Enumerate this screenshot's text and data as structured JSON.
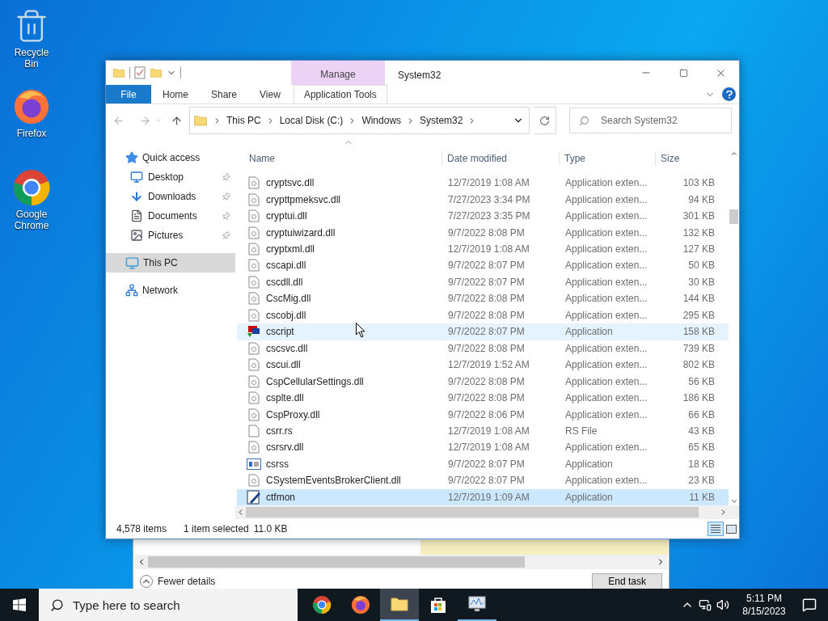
{
  "desktop_icons": [
    {
      "kind": "recycle",
      "label": "Recycle Bin"
    },
    {
      "kind": "firefox",
      "label": "Firefox"
    },
    {
      "kind": "chrome",
      "label": "Google Chrome"
    }
  ],
  "explorer": {
    "title": "System32",
    "contextual_group": "Manage",
    "ribbon_tabs": [
      {
        "kind": "file",
        "label": "File"
      },
      {
        "kind": "tab",
        "label": "Home"
      },
      {
        "kind": "tab",
        "label": "Share"
      },
      {
        "kind": "tab",
        "label": "View"
      },
      {
        "kind": "contextual",
        "label": "Application Tools"
      }
    ],
    "breadcrumbs": [
      "This PC",
      "Local Disk (C:)",
      "Windows",
      "System32"
    ],
    "search": {
      "placeholder": "Search System32"
    },
    "nav": [
      {
        "kind": "star",
        "label": "Quick access",
        "selected": false,
        "children": [
          {
            "kind": "desktop",
            "label": "Desktop",
            "pinned": true,
            "selected": false
          },
          {
            "kind": "downloads",
            "label": "Downloads",
            "pinned": true,
            "selected": false
          },
          {
            "kind": "documents",
            "label": "Documents",
            "pinned": true,
            "selected": false
          },
          {
            "kind": "pictures",
            "label": "Pictures",
            "pinned": true,
            "selected": false
          }
        ]
      },
      {
        "kind": "pc",
        "label": "This PC",
        "selected": true
      },
      {
        "kind": "network",
        "label": "Network",
        "selected": false
      }
    ],
    "columns": [
      "Name",
      "Date modified",
      "Type",
      "Size"
    ],
    "rows": [
      {
        "kind": "dll",
        "name": "cryptsvc.dll",
        "date": "12/7/2019 1:08 AM",
        "type": "Application exten...",
        "size": "103 KB",
        "selected": false,
        "hovered": false
      },
      {
        "kind": "dll",
        "name": "crypttpmeksvc.dll",
        "date": "7/27/2023 3:34 PM",
        "type": "Application exten...",
        "size": "94 KB",
        "selected": false,
        "hovered": false
      },
      {
        "kind": "dll",
        "name": "cryptui.dll",
        "date": "7/27/2023 3:35 PM",
        "type": "Application exten...",
        "size": "301 KB",
        "selected": false,
        "hovered": false
      },
      {
        "kind": "dll",
        "name": "cryptuiwizard.dll",
        "date": "9/7/2022 8:08 PM",
        "type": "Application exten...",
        "size": "132 KB",
        "selected": false,
        "hovered": false
      },
      {
        "kind": "dll",
        "name": "cryptxml.dll",
        "date": "12/7/2019 1:08 AM",
        "type": "Application exten...",
        "size": "127 KB",
        "selected": false,
        "hovered": false
      },
      {
        "kind": "dll",
        "name": "cscapi.dll",
        "date": "9/7/2022 8:07 PM",
        "type": "Application exten...",
        "size": "50 KB",
        "selected": false,
        "hovered": false
      },
      {
        "kind": "dll",
        "name": "cscdll.dll",
        "date": "9/7/2022 8:07 PM",
        "type": "Application exten...",
        "size": "30 KB",
        "selected": false,
        "hovered": false
      },
      {
        "kind": "dll",
        "name": "CscMig.dll",
        "date": "9/7/2022 8:08 PM",
        "type": "Application exten...",
        "size": "144 KB",
        "selected": false,
        "hovered": false
      },
      {
        "kind": "dll",
        "name": "cscobj.dll",
        "date": "9/7/2022 8:08 PM",
        "type": "Application exten...",
        "size": "295 KB",
        "selected": false,
        "hovered": false
      },
      {
        "kind": "script",
        "name": "cscript",
        "date": "9/7/2022 8:07 PM",
        "type": "Application",
        "size": "158 KB",
        "selected": false,
        "hovered": true
      },
      {
        "kind": "dll",
        "name": "cscsvc.dll",
        "date": "9/7/2022 8:08 PM",
        "type": "Application exten...",
        "size": "739 KB",
        "selected": false,
        "hovered": false
      },
      {
        "kind": "dll",
        "name": "cscui.dll",
        "date": "12/7/2019 1:52 AM",
        "type": "Application exten...",
        "size": "802 KB",
        "selected": false,
        "hovered": false
      },
      {
        "kind": "dll",
        "name": "CspCellularSettings.dll",
        "date": "9/7/2022 8:08 PM",
        "type": "Application exten...",
        "size": "56 KB",
        "selected": false,
        "hovered": false
      },
      {
        "kind": "dll",
        "name": "csplte.dll",
        "date": "9/7/2022 8:08 PM",
        "type": "Application exten...",
        "size": "186 KB",
        "selected": false,
        "hovered": false
      },
      {
        "kind": "dll",
        "name": "CspProxy.dll",
        "date": "9/7/2022 8:06 PM",
        "type": "Application exten...",
        "size": "66 KB",
        "selected": false,
        "hovered": false
      },
      {
        "kind": "file",
        "name": "csrr.rs",
        "date": "12/7/2019 1:08 AM",
        "type": "RS File",
        "size": "43 KB",
        "selected": false,
        "hovered": false
      },
      {
        "kind": "dll",
        "name": "csrsrv.dll",
        "date": "12/7/2019 1:08 AM",
        "type": "Application exten...",
        "size": "65 KB",
        "selected": false,
        "hovered": false
      },
      {
        "kind": "window",
        "name": "csrss",
        "date": "9/7/2022 8:07 PM",
        "type": "Application",
        "size": "18 KB",
        "selected": false,
        "hovered": false
      },
      {
        "kind": "dll",
        "name": "CSystemEventsBrokerClient.dll",
        "date": "9/7/2022 8:07 PM",
        "type": "Application exten...",
        "size": "23 KB",
        "selected": false,
        "hovered": false
      },
      {
        "kind": "edit",
        "name": "ctfmon",
        "date": "12/7/2019 1:09 AM",
        "type": "Application",
        "size": "11 KB",
        "selected": true,
        "hovered": false
      }
    ],
    "status": {
      "count": "4,578 items",
      "selection": "1 item selected",
      "size": "11.0 KB"
    }
  },
  "background_window": {
    "details_toggle": "Fewer details",
    "end_button": "End task"
  },
  "taskbar": {
    "search_placeholder": "Type here to search",
    "apps": [
      {
        "kind": "chrome",
        "active": false,
        "running": false
      },
      {
        "kind": "firefox",
        "active": false,
        "running": false
      },
      {
        "kind": "explorer",
        "active": true,
        "running": true
      },
      {
        "kind": "store",
        "active": false,
        "running": false
      },
      {
        "kind": "monitor",
        "active": false,
        "running": true
      }
    ],
    "time": "5:11 PM",
    "date": "8/15/2023"
  }
}
